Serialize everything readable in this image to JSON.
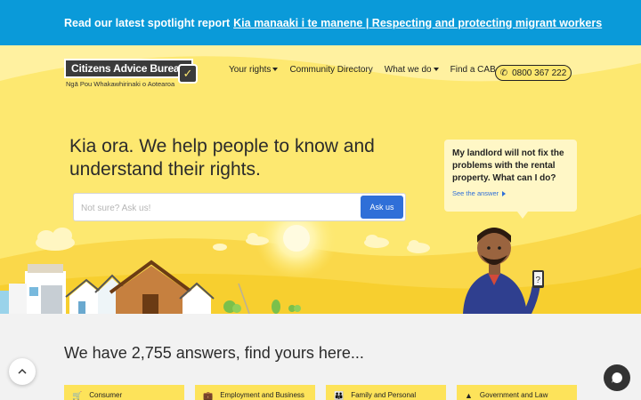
{
  "announcement": {
    "prefix": "Read our latest spotlight report",
    "link": "Kia manaaki i te manene | Respecting and protecting migrant workers"
  },
  "logo": {
    "name": "Citizens Advice Bureau",
    "subtitle": "Ngā Pou Whakawhirinaki o Aotearoa"
  },
  "nav": {
    "items": [
      {
        "label": "Your rights",
        "dropdown": true
      },
      {
        "label": "Community Directory",
        "dropdown": false
      },
      {
        "label": "What we do",
        "dropdown": true
      },
      {
        "label": "Find a CAB",
        "dropdown": true
      }
    ],
    "phone": "0800 367 222"
  },
  "hero": {
    "headline": "Kia ora. We help people to know and understand their rights.",
    "search_placeholder": "Not sure? Ask us!",
    "ask_button": "Ask us",
    "bubble_question": "My landlord will not fix the problems with the rental property. What can I do?",
    "bubble_link": "See the answer"
  },
  "answers": {
    "title": "We have 2,755 answers, find yours here...",
    "categories": [
      {
        "label": "Consumer",
        "icon": "cart-icon"
      },
      {
        "label": "Employment and Business",
        "icon": "briefcase-icon"
      },
      {
        "label": "Family and Personal",
        "icon": "family-icon"
      },
      {
        "label": "Government and Law",
        "icon": "government-icon"
      }
    ]
  },
  "colors": {
    "announcement_bg": "#0a9ad9",
    "hero_bg": "#fde870",
    "accent": "#2f6fd8",
    "category_bg": "#fde35a"
  }
}
